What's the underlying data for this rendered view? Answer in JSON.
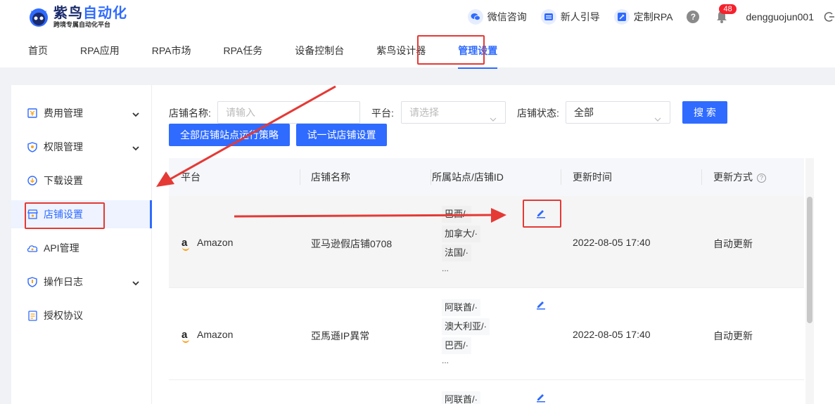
{
  "logo": {
    "name_main": "紫鸟",
    "name_accent": "自动化",
    "subtitle": "跨境专属自动化平台"
  },
  "top_bar": {
    "wechat": "微信咨询",
    "guide": "新人引导",
    "custom_rpa": "定制RPA",
    "help": "?",
    "notification_count": "48",
    "username": "dengguojun001"
  },
  "nav": {
    "items": [
      "首页",
      "RPA应用",
      "RPA市场",
      "RPA任务",
      "设备控制台",
      "紫鸟设计器",
      "管理设置"
    ],
    "active": "管理设置"
  },
  "sidebar": {
    "items": [
      {
        "label": "费用管理",
        "icon": "fee-icon",
        "expandable": true
      },
      {
        "label": "权限管理",
        "icon": "shield-icon",
        "expandable": true
      },
      {
        "label": "下载设置",
        "icon": "download-icon",
        "expandable": false
      },
      {
        "label": "店铺设置",
        "icon": "shop-icon",
        "expandable": false,
        "active": true
      },
      {
        "label": "API管理",
        "icon": "cloud-icon",
        "expandable": false
      },
      {
        "label": "操作日志",
        "icon": "shield-icon",
        "expandable": true
      },
      {
        "label": "授权协议",
        "icon": "document-icon",
        "expandable": false
      }
    ]
  },
  "filters": {
    "shop_name_label": "店铺名称:",
    "shop_name_placeholder": "请输入",
    "platform_label": "平台:",
    "platform_placeholder": "请选择",
    "status_label": "店铺状态:",
    "status_value": "全部",
    "search_button": "搜 索",
    "all_sites_button": "全部店铺站点运行策略",
    "try_button": "试一试店铺设置"
  },
  "table": {
    "columns": [
      "平台",
      "店铺名称",
      "所属站点/店铺ID",
      "更新时间",
      "更新方式"
    ],
    "rows": [
      {
        "platform": "Amazon",
        "shop": "亚马逊假店铺0708",
        "sites": [
          "巴西/·",
          "加拿大/·",
          "法国/·"
        ],
        "more": "...",
        "updated": "2022-08-05 17:40",
        "method": "自动更新"
      },
      {
        "platform": "Amazon",
        "shop": "亞馬遜IP異常",
        "sites": [
          "阿联酋/·",
          "澳大利亚/·",
          "巴西/·"
        ],
        "more": "...",
        "updated": "2022-08-05 17:40",
        "method": "自动更新"
      },
      {
        "platform": "",
        "shop": "",
        "sites": [
          "阿联酋/·"
        ],
        "more": "",
        "updated": "",
        "method": ""
      }
    ]
  },
  "colors": {
    "accent": "#2f6bff",
    "annotation": "#e53935"
  }
}
